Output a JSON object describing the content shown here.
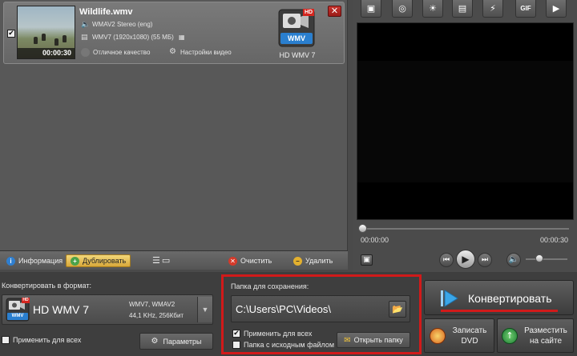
{
  "file_item": {
    "checked": true,
    "title": "Wildlife.wmv",
    "duration": "00:00:30",
    "audio": "WMAV2 Stereo (eng)",
    "video": "WMV7 (1920x1080) (55 МБ)",
    "quality": "Отличное качество",
    "video_settings": "Настройки видео",
    "output_format_badge": "WMV",
    "output_format_hd": "HD",
    "output_format_caption": "HD WMV 7"
  },
  "left_toolbar": {
    "info": "Информация",
    "duplicate": "Дублировать",
    "clear": "Очистить",
    "delete": "Удалить"
  },
  "player": {
    "current_time": "00:00:00",
    "total_time": "00:00:30",
    "progress": 0,
    "top_tools": [
      "crop-icon",
      "effects-icon",
      "brightness-icon",
      "film-icon",
      "speed-icon",
      "gif-icon",
      "export-icon"
    ],
    "gif_label": "GIF"
  },
  "convert_format": {
    "label": "Конвертировать в формат:",
    "format_name": "HD WMV 7",
    "badge": "WMV",
    "hd": "HD",
    "spec_line1": "WMV7, WMAV2",
    "spec_line2": "44,1 KHz, 256Кбит",
    "apply_all": "Применить для всех",
    "params": "Параметры"
  },
  "save_folder": {
    "label": "Папка для сохранения:",
    "path": "C:\\Users\\PC\\Videos\\",
    "apply_all": "Применить для всех",
    "apply_all_checked": true,
    "source_folder": "Папка с исходным файлом",
    "source_folder_checked": false,
    "open_folder": "Открыть папку"
  },
  "actions": {
    "convert": "Конвертировать",
    "burn_dvd_line1": "Записать",
    "burn_dvd_line2": "DVD",
    "publish_line1": "Разместить",
    "publish_line2": "на сайте"
  },
  "colors": {
    "highlight_red": "#d11a1a",
    "duplicate_bg": "#e3bb52",
    "convert_accent": "#3aa6e8"
  }
}
